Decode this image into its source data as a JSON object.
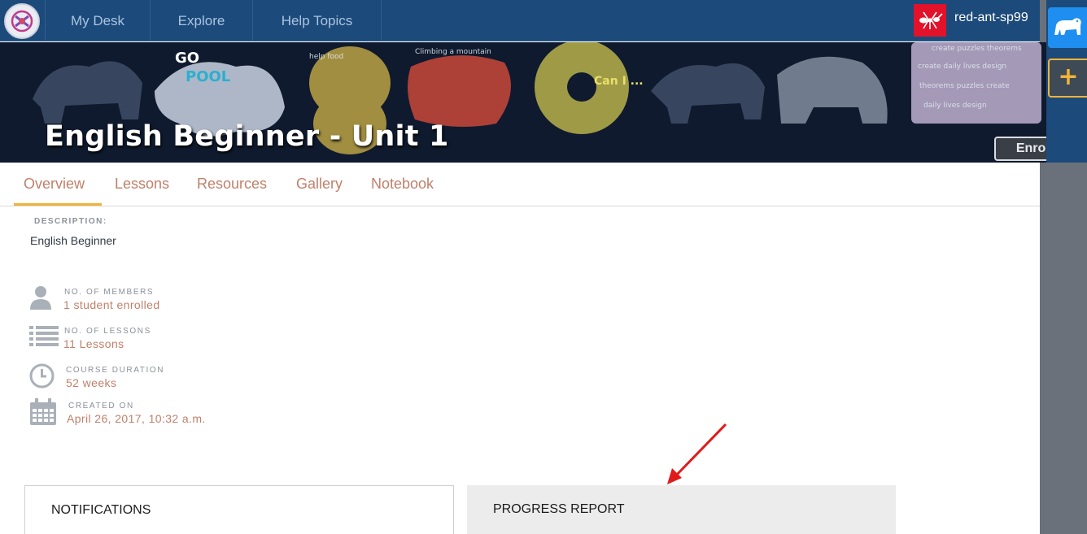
{
  "nav": {
    "items": [
      "My Desk",
      "Explore",
      "Help Topics"
    ],
    "user_name": "red-ant-sp99"
  },
  "course": {
    "title": "English Beginner - Unit 1",
    "enroll_label": "Enroll"
  },
  "tabs": [
    "Overview",
    "Lessons",
    "Resources",
    "Gallery",
    "Notebook"
  ],
  "active_tab": "Overview",
  "description": {
    "label": "DESCRIPTION:",
    "text": "English Beginner"
  },
  "info": [
    {
      "label": "NO. OF MEMBERS",
      "value": "1 student enrolled",
      "icon": "user-icon"
    },
    {
      "label": "NO. OF LESSONS",
      "value": "11 Lessons",
      "icon": "list-icon"
    },
    {
      "label": "COURSE DURATION",
      "value": "52 weeks",
      "icon": "clock-icon"
    },
    {
      "label": "CREATED ON",
      "value": "April 26, 2017, 10:32 a.m.",
      "icon": "calendar-icon"
    }
  ],
  "panels": {
    "notifications": "NOTIFICATIONS",
    "progress_report": "PROGRESS REPORT"
  },
  "colors": {
    "nav_bg": "#1c4a7a",
    "accent": "#f0b43a",
    "link": "#c0806a",
    "rail": "#6a717b",
    "annotation_arrow": "#e01b1b"
  }
}
